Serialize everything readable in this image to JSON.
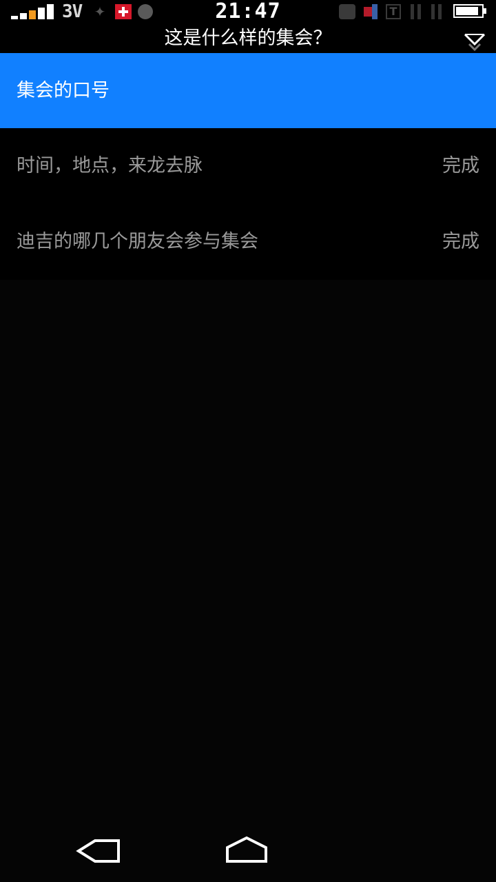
{
  "status_bar": {
    "network_type": "3V",
    "time": "21:47",
    "battery_level": 0.9,
    "icons": [
      "signal-icon",
      "usb-icon",
      "swiss-flag-icon",
      "pacman-icon",
      "app-icon",
      "flag-icon",
      "t-icon",
      "bars-icon",
      "bars-icon",
      "battery-icon"
    ],
    "colors": {
      "signal_accent": "#f29a1f",
      "swiss_flag": "#d6182a"
    }
  },
  "header": {
    "title": "这是什么样的集会？",
    "collapse_icon": "chevron-down-icon"
  },
  "list": {
    "active_item": {
      "label": "集会的口号"
    },
    "items": [
      {
        "label": "时间，地点，来龙去脉",
        "status": "完成"
      },
      {
        "label": "迪吉的哪几个朋友会参与集会",
        "status": "完成"
      }
    ]
  },
  "colors": {
    "accent": "#1180ff",
    "background": "#050505",
    "secondary_text": "#9a9a9a"
  },
  "nav_bar": {
    "back_icon": "back-icon",
    "home_icon": "home-icon"
  }
}
